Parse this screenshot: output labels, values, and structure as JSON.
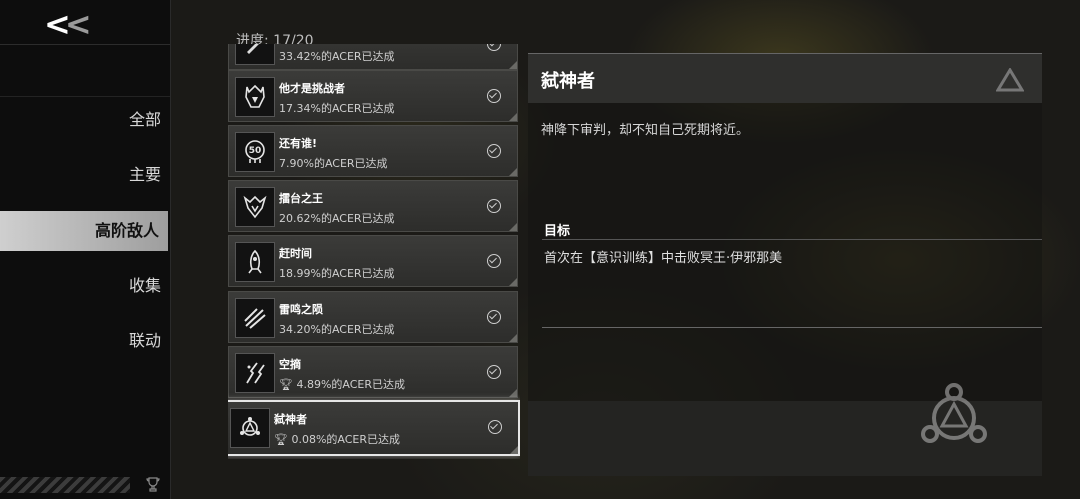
{
  "nav": {
    "back_label": "<<",
    "items": [
      "全部",
      "主要",
      "高阶敌人",
      "收集",
      "联动"
    ],
    "active_index": 2
  },
  "progress": "进度: 17/20",
  "achievements": [
    {
      "title": "",
      "pct": "33.42%的ACER已达成",
      "icon": "blade-icon",
      "completed": true
    },
    {
      "title": "他才是挑战者",
      "pct": "17.34%的ACER已达成",
      "icon": "horned-helmet-icon",
      "completed": true
    },
    {
      "title": "还有谁!",
      "pct": "7.90%的ACER已达成",
      "icon": "skull-50-icon",
      "completed": true
    },
    {
      "title": "擂台之王",
      "pct": "20.62%的ACER已达成",
      "icon": "crowned-beast-icon",
      "completed": true
    },
    {
      "title": "赶时间",
      "pct": "18.99%的ACER已达成",
      "icon": "rocket-icon",
      "completed": true
    },
    {
      "title": "雷鸣之陨",
      "pct": "34.20%的ACER已达成",
      "icon": "slash-marks-icon",
      "completed": true
    },
    {
      "title": "空摘",
      "pct": "4.89%的ACER已达成",
      "icon": "falling-debris-icon",
      "completed": true,
      "trophy": true
    },
    {
      "title": "弑神者",
      "pct": "0.08%的ACER已达成",
      "icon": "triad-emblem-icon",
      "completed": true,
      "trophy": true,
      "selected": true
    }
  ],
  "detail": {
    "title": "弑神者",
    "description": "神降下审判，却不知自己死期将近。",
    "goal_label": "目标",
    "goal_text": "首次在【意识训练】中击败冥王·伊邪那美"
  }
}
